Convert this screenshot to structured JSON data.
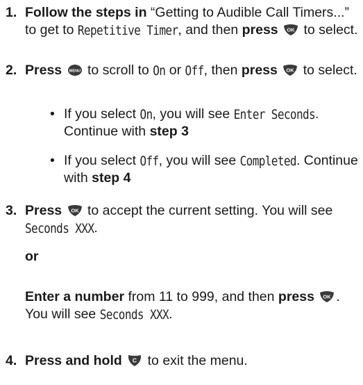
{
  "steps": [
    {
      "number": "1.",
      "bold1": "Follow the steps in",
      "text1": " “Getting to Audible Call Timers...” to get to ",
      "disp1": "Repetitive Timer",
      "text2": ", and then ",
      "bold2": "press",
      "icon": "ok-button-icon",
      "text3": " to select."
    },
    {
      "number": "2.",
      "bold1": "Press",
      "icon1": "menu-button-icon",
      "text1": " to scroll to ",
      "disp1": "On",
      "text2": " or ",
      "disp2": "Off",
      "text3": ", then ",
      "bold2": "press",
      "icon2": "ok-button-icon",
      "text4": " to select.",
      "bullets": [
        {
          "text1": "If you select ",
          "disp1": "On",
          "text2": ", you will see ",
          "disp2": "Enter Seconds",
          "text3": ". Continue with ",
          "bold1": "step 3"
        },
        {
          "text1": "If you select ",
          "disp1": "Off",
          "text2": ", you will see ",
          "disp2": "Completed",
          "text3": ". Continue with ",
          "bold1": "step 4"
        }
      ]
    },
    {
      "number": "3.",
      "bold1": "Press",
      "icon": "ok-button-icon",
      "text1": " to accept the current setting. You will see ",
      "disp1": "Seconds XXX",
      "text2": ".",
      "or_label": "or",
      "alt_bold1": "Enter a number",
      "alt_text1": " from 11 to 999, and then ",
      "alt_bold2": "press",
      "alt_icon": "ok-button-icon",
      "alt_text2": ". You will see ",
      "alt_disp1": "Seconds XXX",
      "alt_text3": "."
    },
    {
      "number": "4.",
      "bold1": "Press and hold",
      "icon": "clear-button-icon",
      "text1": " to exit the menu."
    }
  ],
  "colors": {
    "text": "#1a1a1a",
    "icon": "#3a3a3a"
  }
}
